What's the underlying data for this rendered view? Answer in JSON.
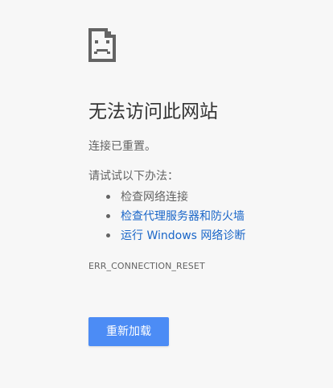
{
  "error_page": {
    "icon": "sad-page-icon",
    "title": "无法访问此网站",
    "summary": "连接已重置。",
    "suggestions_intro": "请试试以下办法：",
    "suggestions": [
      {
        "label": "检查网络连接",
        "is_link": false
      },
      {
        "label": "检查代理服务器和防火墙",
        "is_link": true
      },
      {
        "label": "运行 Windows 网络诊断",
        "is_link": true
      }
    ],
    "error_code": "ERR_CONNECTION_RESET",
    "reload_label": "重新加载"
  },
  "colors": {
    "background": "#f7f7f7",
    "title": "#333333",
    "body_text": "#646464",
    "link": "#1a66c8",
    "button": "#4c8cf5",
    "button_text": "#ffffff"
  }
}
